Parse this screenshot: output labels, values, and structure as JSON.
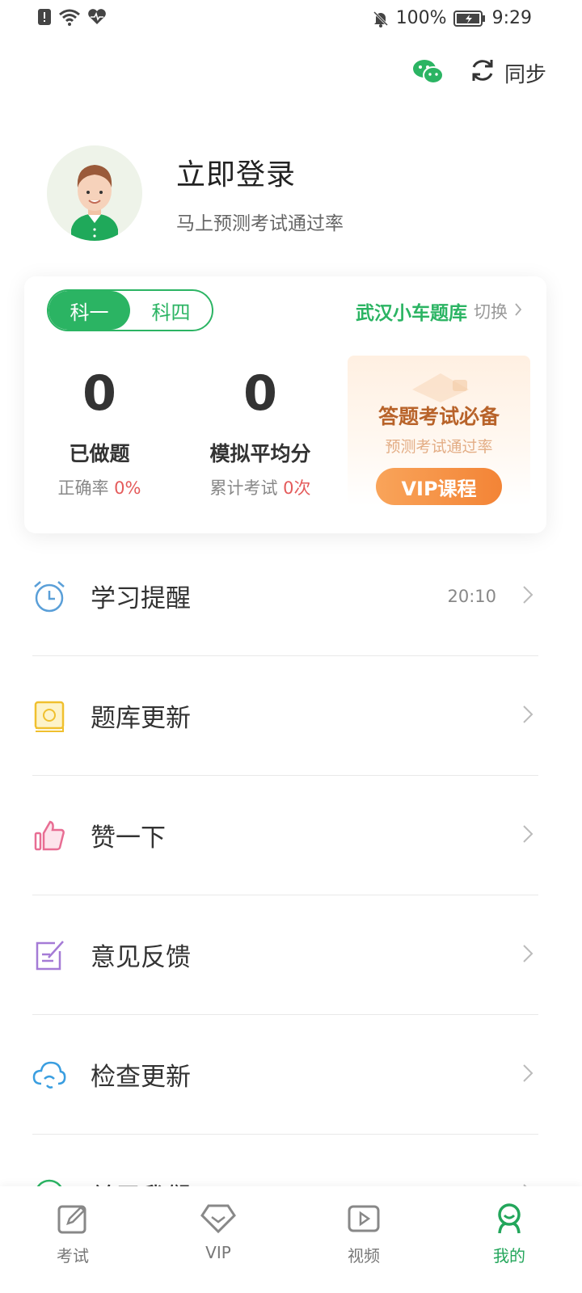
{
  "status_bar": {
    "battery": "100%",
    "time": "9:29"
  },
  "top_actions": {
    "sync_label": "同步",
    "wechat_icon": "wechat-icon",
    "sync_icon": "sync-icon"
  },
  "profile": {
    "login_title": "立即登录",
    "login_subtitle": "马上预测考试通过率"
  },
  "card": {
    "segments": [
      "科一",
      "科四"
    ],
    "selected_segment": "科一",
    "bank_name": "武汉小车题库",
    "bank_switch": "切换",
    "stats": [
      {
        "value": "0",
        "label": "已做题",
        "sub_prefix": "正确率 ",
        "sub_value": "0%"
      },
      {
        "value": "0",
        "label": "模拟平均分",
        "sub_prefix": "累计考试 ",
        "sub_value": "0次"
      }
    ],
    "promo": {
      "title": "答题考试必备",
      "subtitle": "预测考试通过率",
      "button": "VIP课程"
    }
  },
  "menu": [
    {
      "label": "学习提醒",
      "value": "20:10",
      "icon": "alarm-clock-icon"
    },
    {
      "label": "题库更新",
      "value": "",
      "icon": "book-update-icon"
    },
    {
      "label": "赞一下",
      "value": "",
      "icon": "thumbs-up-icon"
    },
    {
      "label": "意见反馈",
      "value": "",
      "icon": "feedback-edit-icon"
    },
    {
      "label": "检查更新",
      "value": "",
      "icon": "cloud-refresh-icon"
    },
    {
      "label": "关于我们",
      "value": "",
      "icon": "info-icon"
    }
  ],
  "tabs": [
    {
      "label": "考试",
      "icon": "edit-icon",
      "active": false
    },
    {
      "label": "VIP",
      "icon": "diamond-icon",
      "active": false
    },
    {
      "label": "视频",
      "icon": "play-icon",
      "active": false
    },
    {
      "label": "我的",
      "icon": "person-icon",
      "active": true
    }
  ],
  "colors": {
    "accent": "#2bb463",
    "red": "#e45b5b",
    "promo_brown": "#b8632a",
    "vip_orange": "#f38436"
  }
}
